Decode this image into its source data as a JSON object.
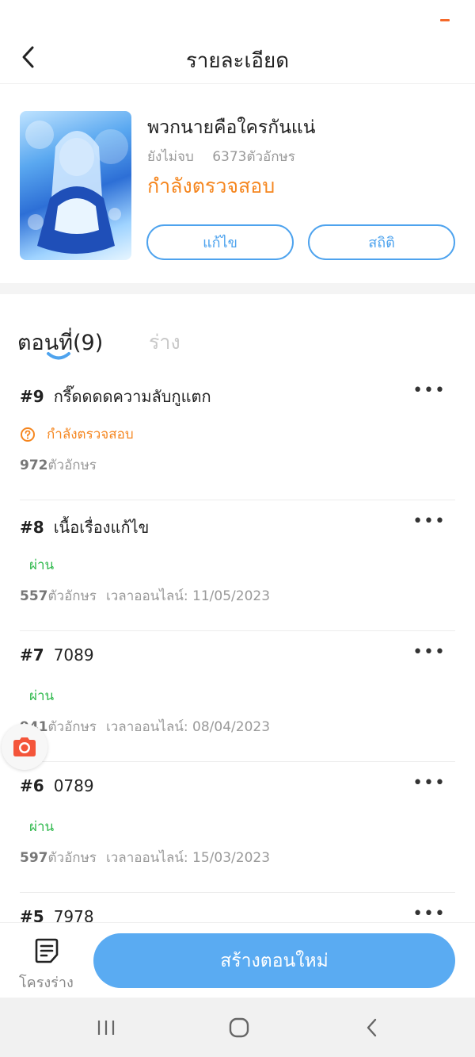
{
  "header": {
    "title": "รายละเอียด",
    "back_icon": "chevron-left-icon"
  },
  "book": {
    "title": "พวกนายคือใครกันแน่",
    "progress_status": "ยังไม่จบ",
    "word_count": "6373ตัวอักษร",
    "review_status": "กำลังตรวจสอบ",
    "edit_label": "แก้ไข",
    "stats_label": "สถิติ"
  },
  "tabs": {
    "chapters_label": "ตอนที่(9)",
    "drafts_label": "ร่าง"
  },
  "chapters": [
    {
      "number": "#9",
      "title": "กรี๊ดดดดความลับกูแตก",
      "status": "กำลังตรวจสอบ",
      "count": "972",
      "unit": "ตัวอักษร",
      "online_label": "",
      "date": ""
    },
    {
      "number": "#8",
      "title": "เนื้อเรื่องแก้ไข",
      "status": "ผ่าน",
      "count": "557",
      "unit": "ตัวอักษร",
      "online_label": "เวลาออนไลน์:",
      "date": "11/05/2023"
    },
    {
      "number": "#7",
      "title": "7089",
      "status": "ผ่าน",
      "count": "941",
      "unit": "ตัวอักษร",
      "online_label": "เวลาออนไลน์:",
      "date": "08/04/2023"
    },
    {
      "number": "#6",
      "title": "0789",
      "status": "ผ่าน",
      "count": "597",
      "unit": "ตัวอักษร",
      "online_label": "เวลาออนไลน์:",
      "date": "15/03/2023"
    },
    {
      "number": "#5",
      "title": "7978",
      "status": "",
      "count": "",
      "unit": "",
      "online_label": "",
      "date": ""
    }
  ],
  "more_label": "•••",
  "bottom": {
    "draft_label": "โครงร่าง",
    "create_label": "สร้างตอนใหม่"
  },
  "colors": {
    "accent_blue": "#4ea3ee",
    "review_orange": "#f5861f",
    "pass_green": "#2db84b",
    "primary_button": "#5aabf2"
  }
}
